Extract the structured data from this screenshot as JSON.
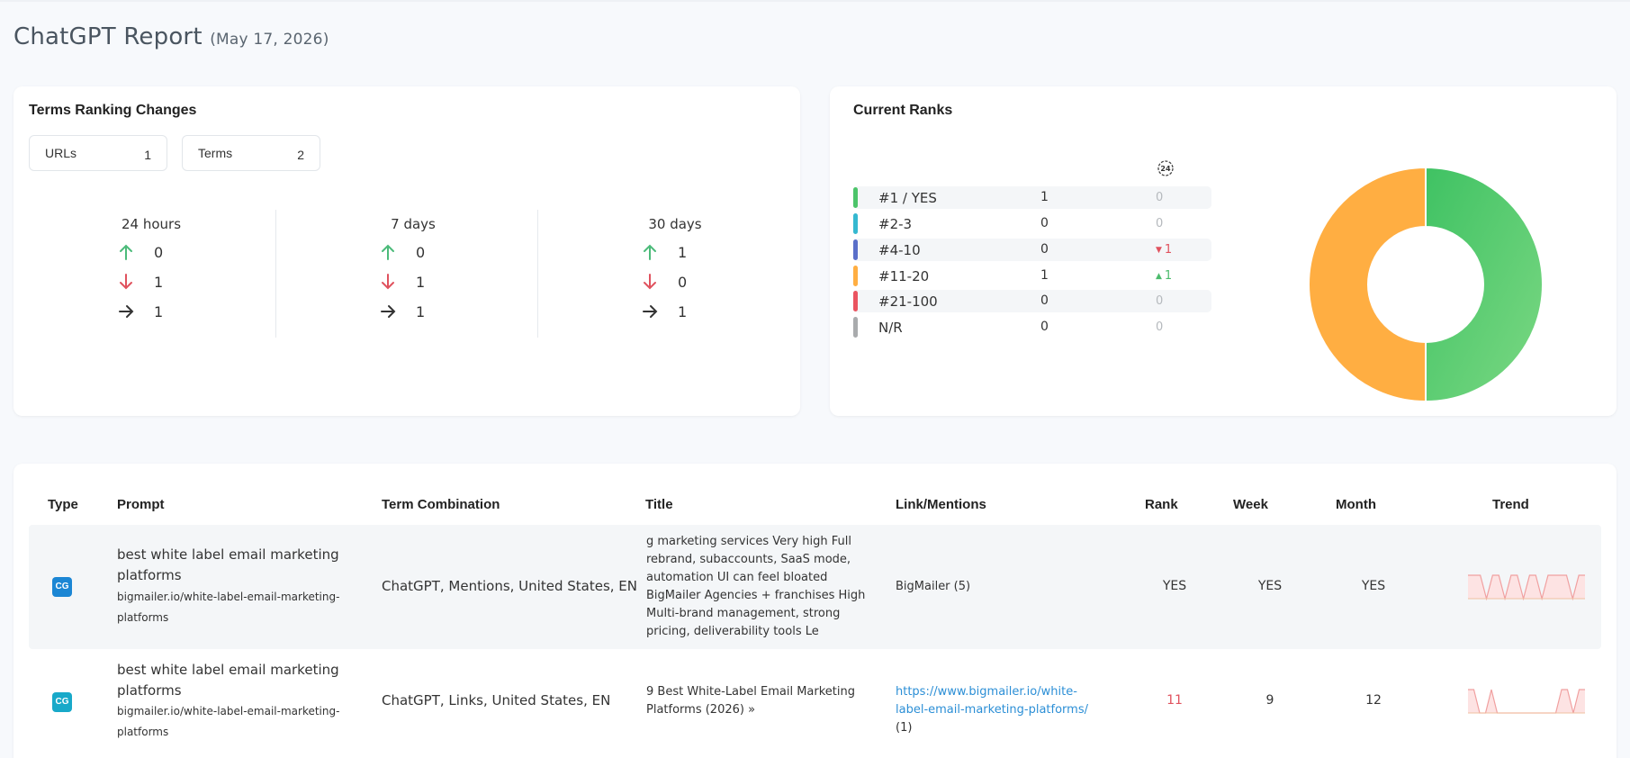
{
  "page": {
    "title": "ChatGPT Report",
    "date": "(May 17, 2026)"
  },
  "changes": {
    "title": "Terms Ranking Changes",
    "urls_label": "URLs",
    "urls_value": "1",
    "terms_label": "Terms",
    "terms_value": "2",
    "periods": [
      {
        "label": "24 hours",
        "up": "0",
        "down": "1",
        "same": "1"
      },
      {
        "label": "7 days",
        "up": "0",
        "down": "1",
        "same": "1"
      },
      {
        "label": "30 days",
        "up": "1",
        "down": "0",
        "same": "1"
      }
    ]
  },
  "ranks": {
    "title": "Current Ranks",
    "clock_label": "24",
    "rows": [
      {
        "label": "#1 / YES",
        "count": "1",
        "change": "0",
        "dir": "none",
        "color": "#4cc46a"
      },
      {
        "label": "#2-3",
        "count": "0",
        "change": "0",
        "dir": "none",
        "color": "#35b8d0"
      },
      {
        "label": "#4-10",
        "count": "0",
        "change": "1",
        "dir": "down",
        "color": "#5a6fc9"
      },
      {
        "label": "#11-20",
        "count": "1",
        "change": "1",
        "dir": "up",
        "color": "#ffae42"
      },
      {
        "label": "#21-100",
        "count": "0",
        "change": "0",
        "dir": "none",
        "color": "#ea5460"
      },
      {
        "label": "N/R",
        "count": "0",
        "change": "0",
        "dir": "none",
        "color": "#a9abad"
      }
    ],
    "donut": {
      "slices": [
        {
          "label": "#1 / YES",
          "value": 1,
          "color": "#4cc46a"
        },
        {
          "label": "#11-20",
          "value": 1,
          "color": "#ffae42"
        }
      ]
    }
  },
  "table": {
    "headers": {
      "type": "Type",
      "prompt": "Prompt",
      "combo": "Term Combination",
      "title": "Title",
      "link": "Link/Mentions",
      "rank": "Rank",
      "week": "Week",
      "month": "Month",
      "trend": "Trend"
    },
    "rows": [
      {
        "badge": "CG",
        "badge_color": "#1b86d4",
        "prompt": "best white label email marketing platforms",
        "url": "bigmailer.io/white-label-email-marketing-platforms",
        "combo": "ChatGPT, Mentions, United States, EN",
        "title": "g marketing services Very high Full rebrand, subaccounts, SaaS mode, automation UI can feel bloated BigMailer Agencies + franchises High Multi-brand management, strong pricing, deliverability tools Le",
        "link_text": "BigMailer",
        "link_count": "(5)",
        "rank": "YES",
        "week": "YES",
        "month": "YES",
        "trend": [
          1,
          1,
          1,
          0,
          1,
          1,
          0,
          1,
          1,
          0,
          1,
          1,
          0,
          1,
          1,
          1,
          1,
          0,
          1,
          1
        ]
      },
      {
        "badge": "CG",
        "badge_color": "#18a9c9",
        "prompt": "best white label email marketing platforms",
        "url": "bigmailer.io/white-label-email-marketing-platforms",
        "combo": "ChatGPT, Links, United States, EN",
        "title": "9 Best White-Label Email Marketing Platforms (2026) »",
        "link_text": "https://www.bigmailer.io/white-label-email-marketing-platforms/",
        "link_count": "(1)",
        "rank": "11",
        "week": "9",
        "month": "12",
        "trend": [
          1,
          1,
          0,
          0,
          1,
          0,
          0,
          0,
          0,
          0,
          0,
          0,
          0,
          0,
          0,
          0,
          1,
          1,
          0,
          1,
          1
        ]
      }
    ]
  }
}
